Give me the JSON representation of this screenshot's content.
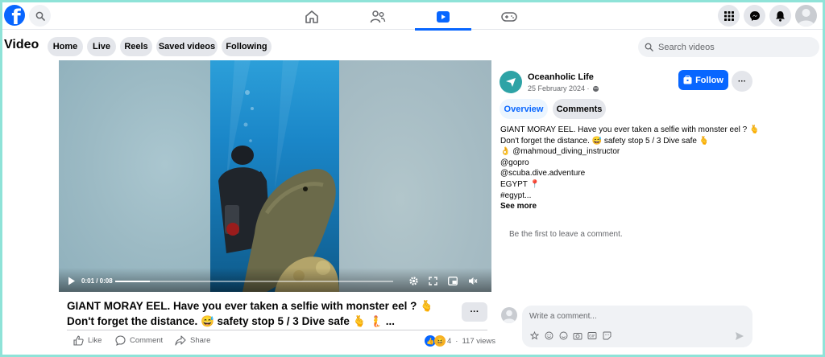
{
  "nav": {
    "logo_letter": "f",
    "icons": [
      "home-icon",
      "friends-icon",
      "video-icon",
      "gaming-icon"
    ],
    "active": "video-icon",
    "right_icons": [
      "menu-grid-icon",
      "messenger-icon",
      "notifications-icon",
      "account-icon"
    ]
  },
  "header": {
    "title": "Video",
    "pills": [
      "Home",
      "Live",
      "Reels",
      "Saved videos",
      "Following"
    ],
    "search_placeholder": "Search videos"
  },
  "player": {
    "time": "0:01 / 0:08",
    "progress": 0.125
  },
  "post": {
    "title_line1": "GIANT MORAY EEL. Have you ever taken a selfie with monster eel ? 🫰",
    "title_line2": "Don't forget the distance. 😅 safety stop 5 / 3 Dive safe 🫰 🧜 ...",
    "more_label": "···",
    "actions": {
      "like": "Like",
      "comment": "Comment",
      "share": "Share"
    },
    "reaction_count": "4",
    "views": "117 views",
    "separator": "·"
  },
  "page": {
    "name": "Oceanholic Life",
    "date": "25 February 2024 ·",
    "follow_label": "Follow",
    "tabs": [
      "Overview",
      "Comments"
    ],
    "description": [
      "GIANT MORAY EEL. Have you ever taken a selfie with monster eel ? 🫰",
      "Don't forget the distance. 😅 safety stop 5 / 3 Dive safe 🫰",
      "👌 @mahmoud_diving_instructor",
      "@gopro",
      "@scuba.dive.adventure",
      "EGYPT 📍",
      "#egypt..."
    ],
    "see_more": "See more",
    "empty_comments": "Be the first to leave a comment.",
    "comment_placeholder": "Write a comment..."
  },
  "colors": {
    "brand_blue": "#0866ff",
    "page_avatar": "#2ea3a6",
    "outer_border": "#8fe3d8"
  }
}
